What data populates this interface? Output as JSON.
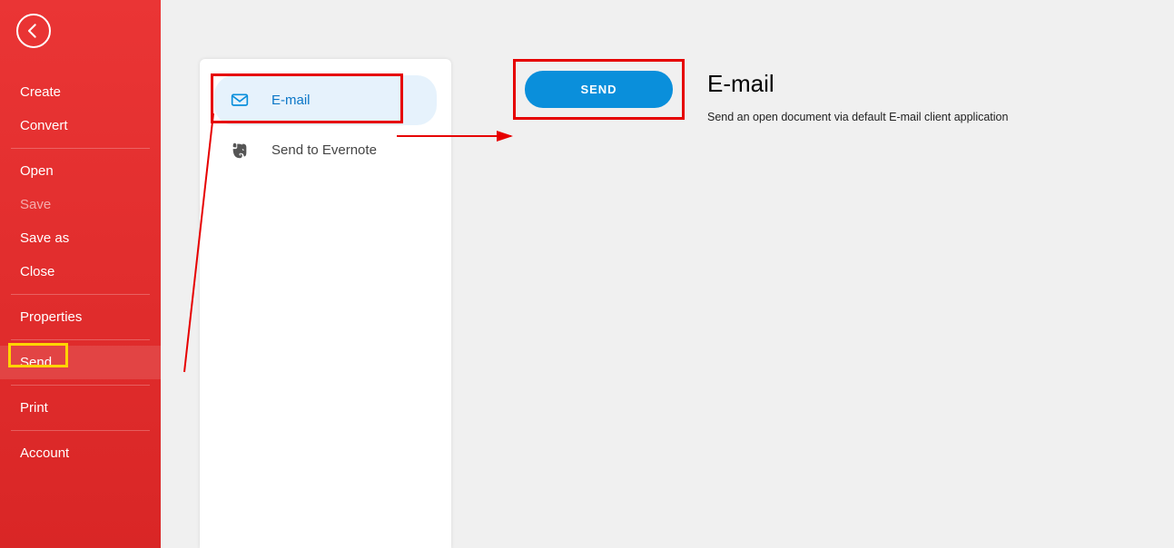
{
  "sidebar": {
    "items": [
      {
        "label": "Create",
        "disabled": false
      },
      {
        "label": "Convert",
        "disabled": false
      },
      {
        "label": "Open",
        "disabled": false
      },
      {
        "label": "Save",
        "disabled": true
      },
      {
        "label": "Save as",
        "disabled": false
      },
      {
        "label": "Close",
        "disabled": false
      },
      {
        "label": "Properties",
        "disabled": false
      },
      {
        "label": "Send",
        "disabled": false,
        "selected": true,
        "highlighted": "yellow"
      },
      {
        "label": "Print",
        "disabled": false
      },
      {
        "label": "Account",
        "disabled": false
      }
    ]
  },
  "panel": {
    "options": [
      {
        "label": "E-mail",
        "icon": "mail-icon",
        "selected": true,
        "highlighted": "red"
      },
      {
        "label": "Send to Evernote",
        "icon": "evernote-icon",
        "selected": false
      }
    ]
  },
  "action": {
    "button_label": "SEND",
    "title": "E-mail",
    "description": "Send an open document via default E-mail client application"
  },
  "colors": {
    "sidebar_bg": "#e12e2e",
    "accent_blue": "#0a8fdb",
    "highlight_yellow": "#ffd400",
    "highlight_red": "#e60000"
  }
}
